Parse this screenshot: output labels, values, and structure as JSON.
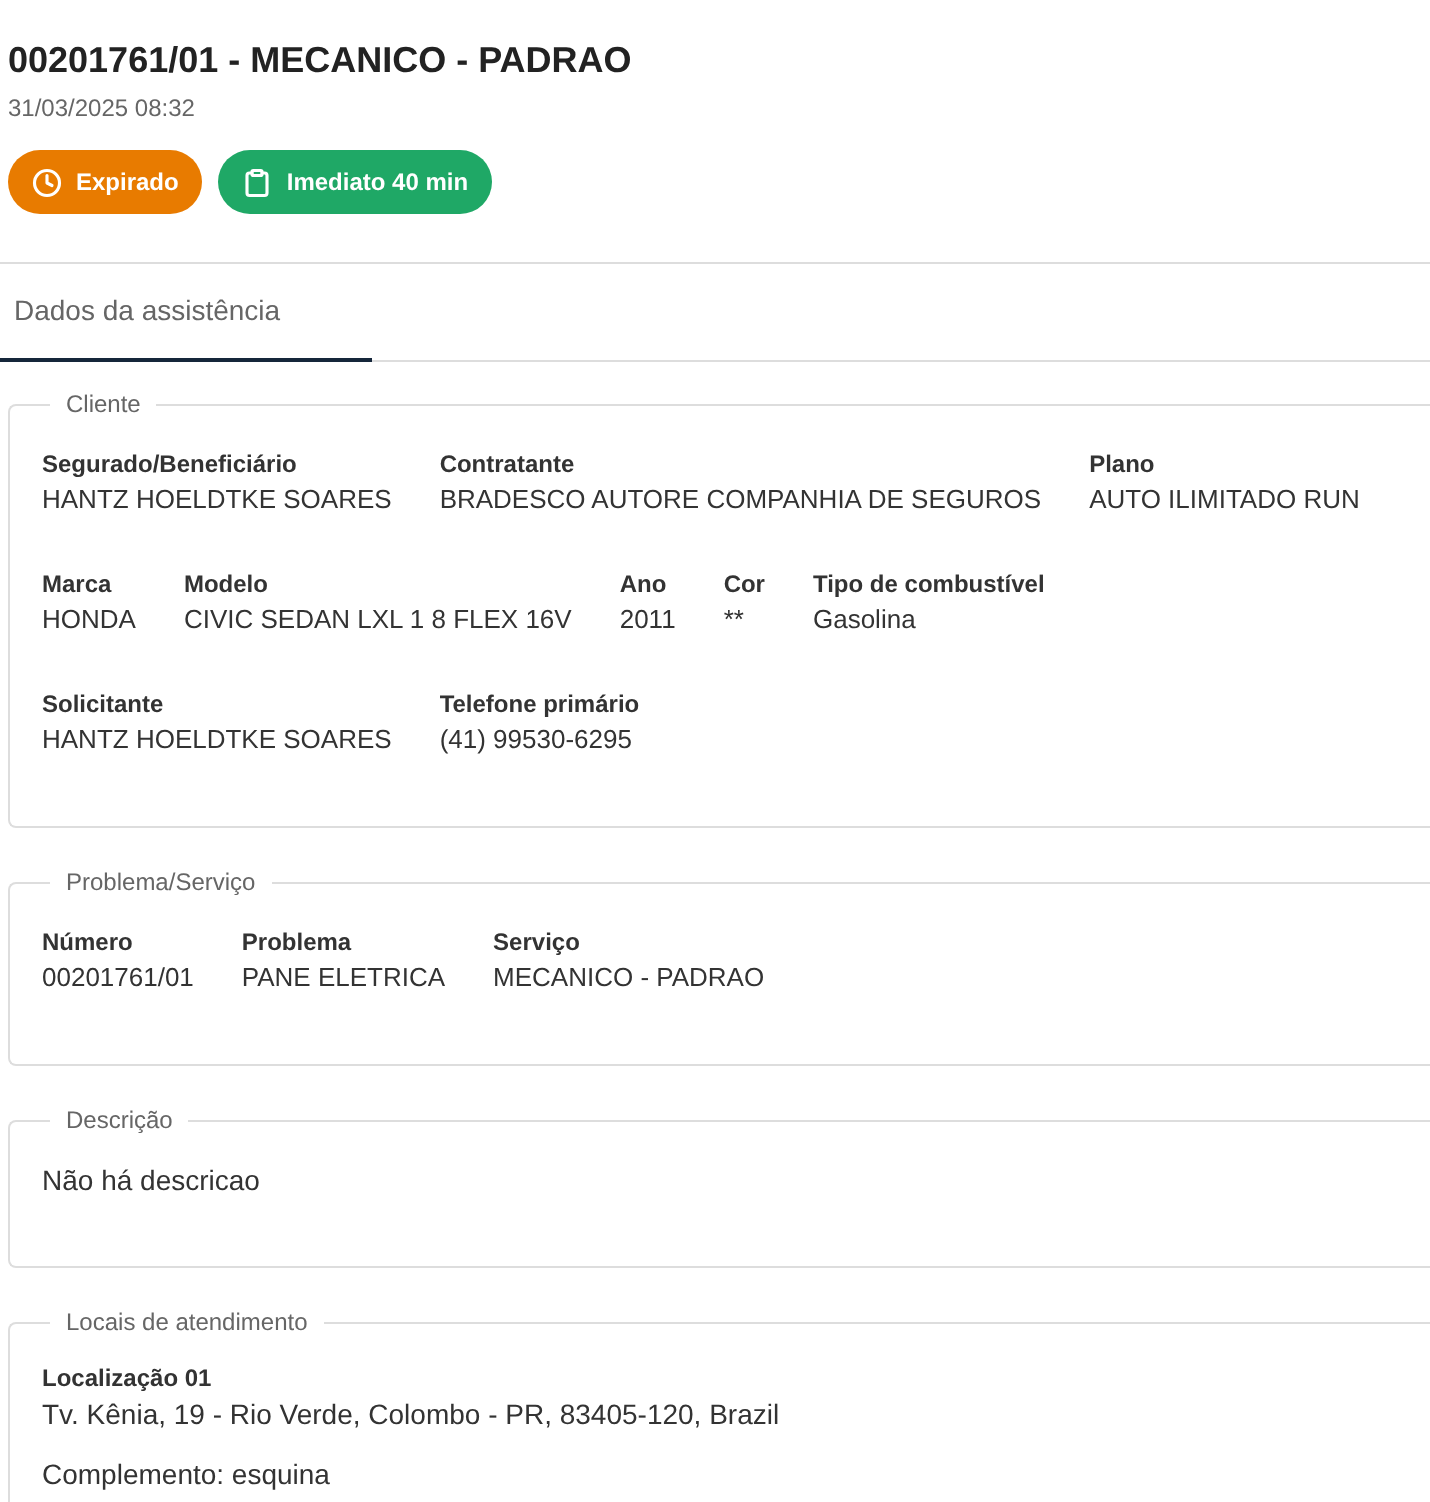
{
  "header": {
    "title": "00201761/01 - MECANICO - PADRAO",
    "datetime": "31/03/2025 08:32"
  },
  "badges": [
    {
      "kind": "clock",
      "label": "Expirado",
      "color": "#e87b00"
    },
    {
      "kind": "clipboard",
      "label": "Imediato 40 min",
      "color": "#1fa866"
    }
  ],
  "tabs": [
    {
      "label": "Dados da assistência",
      "selected": true
    }
  ],
  "sections": [
    {
      "kind": "fields",
      "legend": "Cliente",
      "rows": [
        [
          {
            "label": "Segurado/Beneficiário",
            "value": "HANTZ HOELDTKE SOARES"
          },
          {
            "label": "Contratante",
            "value": "BRADESCO AUTORE COMPANHIA DE SEGUROS"
          },
          {
            "label": "Plano",
            "value": "AUTO ILIMITADO RUN"
          }
        ],
        [
          {
            "label": "Marca",
            "value": "HONDA"
          },
          {
            "label": "Modelo",
            "value": "CIVIC SEDAN LXL 1 8 FLEX 16V"
          },
          {
            "label": "Ano",
            "value": "2011"
          },
          {
            "label": "Cor",
            "value": "**"
          },
          {
            "label": "Tipo de combustível",
            "value": "Gasolina"
          }
        ],
        [
          {
            "label": "Solicitante",
            "value": "HANTZ HOELDTKE SOARES"
          },
          {
            "label": "Telefone primário",
            "value": "(41) 99530-6295"
          }
        ]
      ]
    },
    {
      "kind": "fields",
      "legend": "Problema/Serviço",
      "rows": [
        [
          {
            "label": "Número",
            "value": "00201761/01"
          },
          {
            "label": "Problema",
            "value": "PANE ELETRICA"
          },
          {
            "label": "Serviço",
            "value": "MECANICO - PADRAO"
          }
        ]
      ]
    },
    {
      "kind": "text",
      "legend": "Descrição",
      "text": "Não há descricao"
    },
    {
      "kind": "locations",
      "legend": "Locais de atendimento",
      "locations": [
        {
          "title": "Localização 01",
          "address": "Tv. Kênia, 19 - Rio Verde, Colombo - PR, 83405-120, Brazil",
          "complement": "Complemento: esquina"
        }
      ]
    }
  ]
}
